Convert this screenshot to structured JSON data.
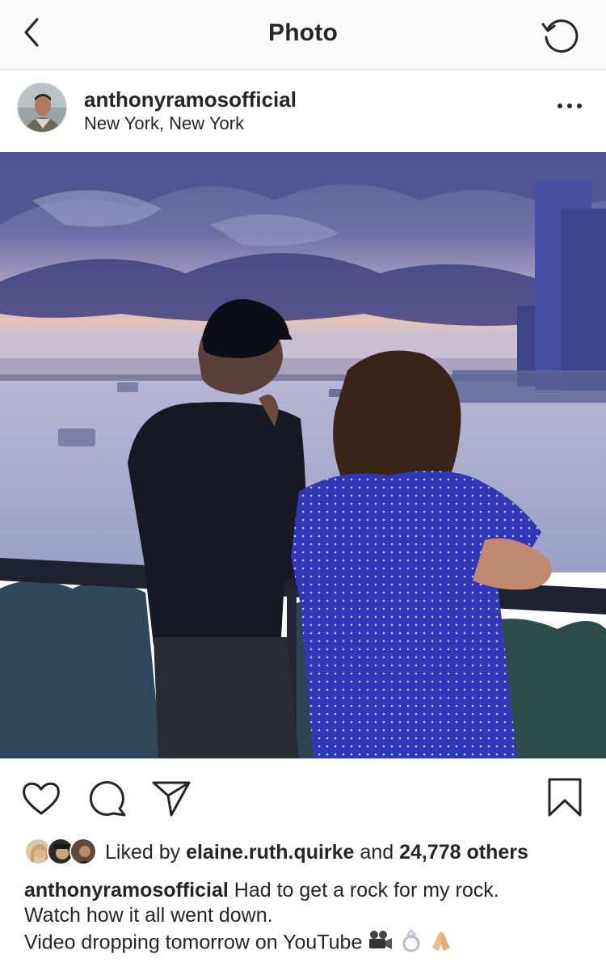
{
  "nav": {
    "title": "Photo",
    "back_icon": "chevron-left-icon",
    "refresh_icon": "refresh-icon"
  },
  "post": {
    "username": "anthonyramosofficial",
    "location": "New York, New York",
    "more_icon": "more-horizontal-icon"
  },
  "actions": {
    "like_icon": "heart-icon",
    "comment_icon": "comment-icon",
    "share_icon": "send-icon",
    "save_icon": "bookmark-icon"
  },
  "likes": {
    "prefix": "Liked by",
    "user": "elaine.ruth.quirke",
    "conjunction": "and",
    "others": "24,778 others"
  },
  "caption": {
    "username": "anthonyramosofficial",
    "line1": "Had to get a rock for my rock.",
    "line2": "Watch how it all went down.",
    "line3": "Video dropping tomorrow on YouTube"
  },
  "colors": {
    "text": "#262626",
    "border": "#dbdbdb",
    "nav_bg": "#fafafa"
  }
}
